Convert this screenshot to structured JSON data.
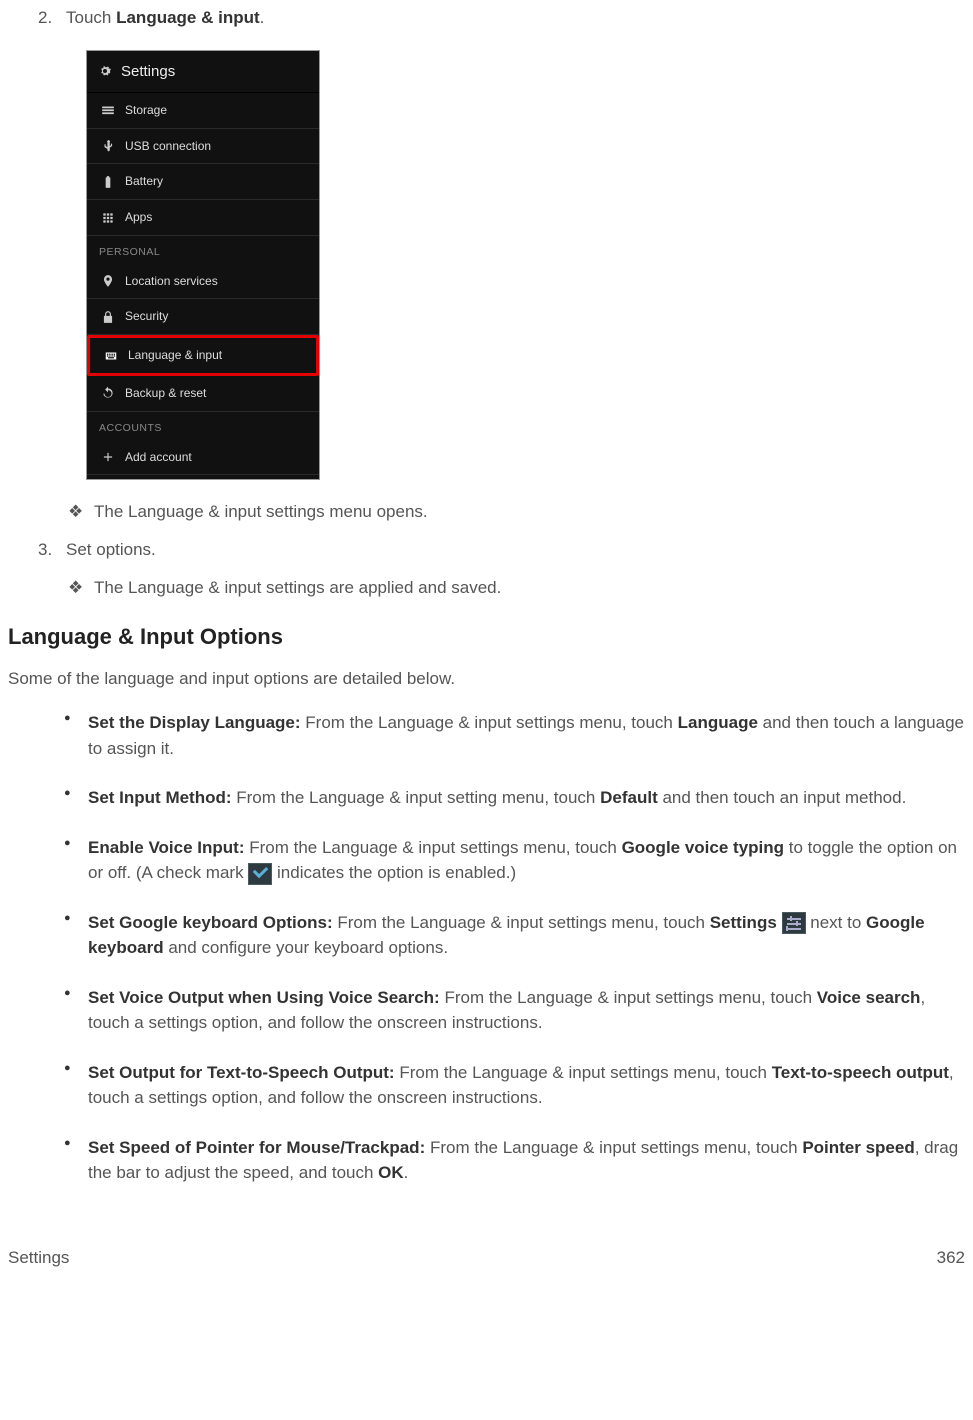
{
  "step2": {
    "num": "2.",
    "prefix": "Touch ",
    "bold": "Language & input",
    "suffix": "."
  },
  "phone": {
    "title": "Settings",
    "rows": [
      {
        "label": "Storage",
        "icon": "storage"
      },
      {
        "label": "USB connection",
        "icon": "usb"
      },
      {
        "label": "Battery",
        "icon": "battery"
      },
      {
        "label": "Apps",
        "icon": "apps"
      }
    ],
    "section1": "PERSONAL",
    "rows2": [
      {
        "label": "Location services",
        "icon": "location"
      },
      {
        "label": "Security",
        "icon": "lock"
      },
      {
        "label": "Language & input",
        "icon": "keyboard",
        "highlight": true
      },
      {
        "label": "Backup & reset",
        "icon": "restore"
      }
    ],
    "section2": "ACCOUNTS",
    "rows3": [
      {
        "label": "Add account",
        "icon": "plus"
      }
    ]
  },
  "d1": "The Language & input settings menu opens.",
  "step3": {
    "num": "3.",
    "text": "Set options."
  },
  "d2": "The Language & input settings are applied and saved.",
  "subheading": "Language & Input Options",
  "intro": "Some of the language and input options are detailed below.",
  "opts": {
    "o1": {
      "b1": "Set the Display Language:",
      "t1": " From the Language & input settings menu, touch ",
      "b2": "Language",
      "t2": " and then touch a language to assign it."
    },
    "o2": {
      "b1": "Set Input Method:",
      "t1": " From the Language & input setting menu, touch ",
      "b2": "Default",
      "t2": " and then touch an input method."
    },
    "o3": {
      "b1": "Enable Voice Input:",
      "t1": " From the Language & input settings menu, touch ",
      "b2": "Google voice typing",
      "t2": " to toggle the option on or off. (A check mark ",
      "t3": " indicates the option is enabled.)"
    },
    "o4": {
      "b1": "Set Google keyboard Options:",
      "t1": " From the Language & input settings menu, touch ",
      "b2": "Settings",
      "t2": " next to ",
      "b3": "Google keyboard",
      "t3": " and configure your keyboard options."
    },
    "o5": {
      "b1": "Set Voice Output when Using Voice Search:",
      "t1": " From the Language & input settings menu, touch ",
      "b2": "Voice search",
      "t2": ", touch a settings option, and follow the onscreen instructions."
    },
    "o6": {
      "b1": "Set Output for Text-to-Speech Output:",
      "t1": " From the Language & input settings menu, touch ",
      "b2": "Text-to-speech output",
      "t2": ", touch a settings option, and follow the onscreen instructions."
    },
    "o7": {
      "b1": "Set Speed of Pointer for Mouse/Trackpad:",
      "t1": " From the Language & input settings menu, touch ",
      "b2": "Pointer speed",
      "t2": ", drag the bar to adjust the speed, and touch ",
      "b3": "OK",
      "t3": "."
    }
  },
  "footer": {
    "left": "Settings",
    "right": "362"
  }
}
